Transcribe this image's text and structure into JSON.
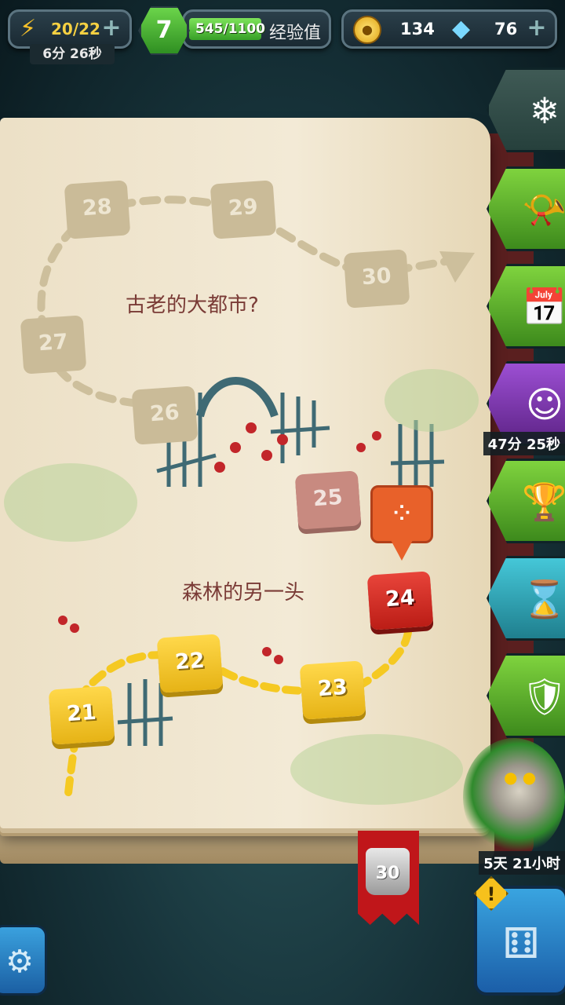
{
  "hud": {
    "energy": "20/22",
    "energy_timer": "6分 26秒",
    "level": "7",
    "xp": "545/1100",
    "xp_label": "经验值",
    "xp_progress": 0.495,
    "coins": "134",
    "gems": "76"
  },
  "map": {
    "region_old_city": "古老的大都市?",
    "region_forest": "森林的另一头",
    "nodes": {
      "n21": "21",
      "n22": "22",
      "n23": "23",
      "n24": "24",
      "n25": "25",
      "n26": "26",
      "n27": "27",
      "n28": "28",
      "n29": "29",
      "n30": "30"
    },
    "boss_weight": "30"
  },
  "side_menu": {
    "character_timer": "47分 25秒",
    "robot_timer": "5天 21小时"
  },
  "icons": {
    "energy": "lightning-icon",
    "coin": "coin-icon",
    "gem": "diamond-icon",
    "settings": "gear-icon",
    "dice": "dice-icon",
    "alert": "exclamation-icon"
  },
  "colors": {
    "accent_green": "#6bd44a",
    "node_completed": "#ffd84a",
    "node_current": "#e8443a",
    "marker": "#e8612a"
  }
}
